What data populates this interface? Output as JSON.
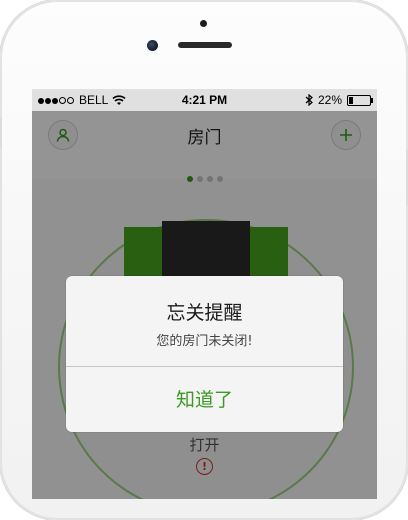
{
  "status_bar": {
    "carrier": "BELL",
    "time": "4:21 PM",
    "battery_percent": "22%",
    "battery_level": 0.22,
    "signal_bars_filled": 3,
    "signal_bars_total": 5,
    "icons": [
      "wifi-icon",
      "bluetooth-icon",
      "battery-icon"
    ]
  },
  "navbar": {
    "title": "房门",
    "left_icon": "user-icon",
    "right_icon": "plus-icon"
  },
  "pager": {
    "count": 4,
    "active": 0
  },
  "device": {
    "action_label": "打开",
    "warning_icon": "exclamation-icon",
    "warning_glyph": "!"
  },
  "alert": {
    "title": "忘关提醒",
    "message": "您的房门未关闭!",
    "confirm_label": "知道了"
  },
  "colors": {
    "accent": "#3a9a22",
    "warning": "#d0342c"
  }
}
